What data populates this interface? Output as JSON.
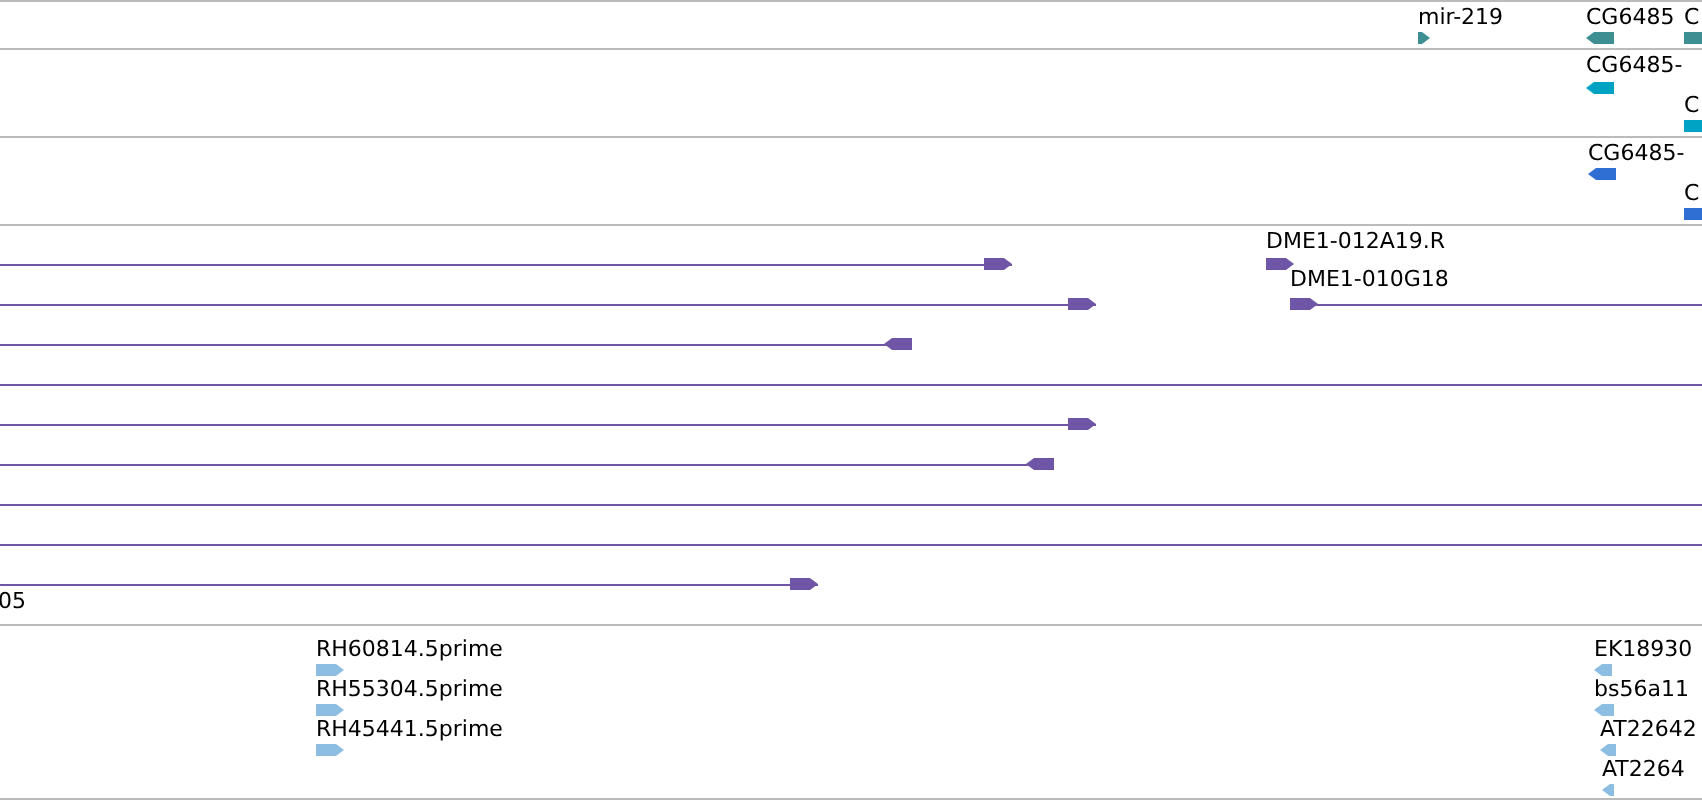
{
  "tracks": [
    {
      "color": "#3d8f92",
      "features": [
        {
          "label": "mir-219",
          "kind": "forward",
          "line": false
        },
        {
          "label": "CG6485",
          "kind": "reverse",
          "line": false
        },
        {
          "label": "C",
          "kind": "block",
          "line": false
        }
      ]
    },
    {
      "color": "#00a3c4",
      "features": [
        {
          "label": "CG6485-",
          "kind": "reverse",
          "line": false
        },
        {
          "label": "C",
          "kind": "block",
          "line": false
        }
      ]
    },
    {
      "color": "#2f6fd3",
      "features": [
        {
          "label": "CG6485-",
          "kind": "reverse",
          "line": false
        },
        {
          "label": "C",
          "kind": "block",
          "line": false
        }
      ]
    },
    {
      "color": "#6f55a6",
      "features": [
        {
          "kind": "forward",
          "line": true
        },
        {
          "label": "DME1-012A19.R",
          "kind": "forward",
          "line": false
        },
        {
          "kind": "forward",
          "line": true
        },
        {
          "label": "DME1-010G18",
          "kind": "forward",
          "line": true
        },
        {
          "kind": "reverse",
          "line": true
        },
        {
          "kind": "plain",
          "line": true
        },
        {
          "kind": "forward",
          "line": true
        },
        {
          "kind": "reverse",
          "line": true
        },
        {
          "kind": "plain",
          "line": true
        },
        {
          "kind": "plain",
          "line": true
        },
        {
          "label": "05",
          "kind": "forward",
          "line": true
        }
      ]
    },
    {
      "color": "#8cbde2",
      "features": [
        {
          "label": "RH60814.5prime",
          "kind": "forward",
          "line": false
        },
        {
          "label": "EK18930",
          "kind": "reverse",
          "line": false
        },
        {
          "label": "RH55304.5prime",
          "kind": "forward",
          "line": false
        },
        {
          "label": "bs56a11",
          "kind": "reverse",
          "line": false
        },
        {
          "label": "RH45441.5prime",
          "kind": "forward",
          "line": false
        },
        {
          "label": "AT22642",
          "kind": "reverse",
          "line": false
        },
        {
          "label": "AT2264",
          "kind": "reverse",
          "line": false
        }
      ]
    }
  ]
}
